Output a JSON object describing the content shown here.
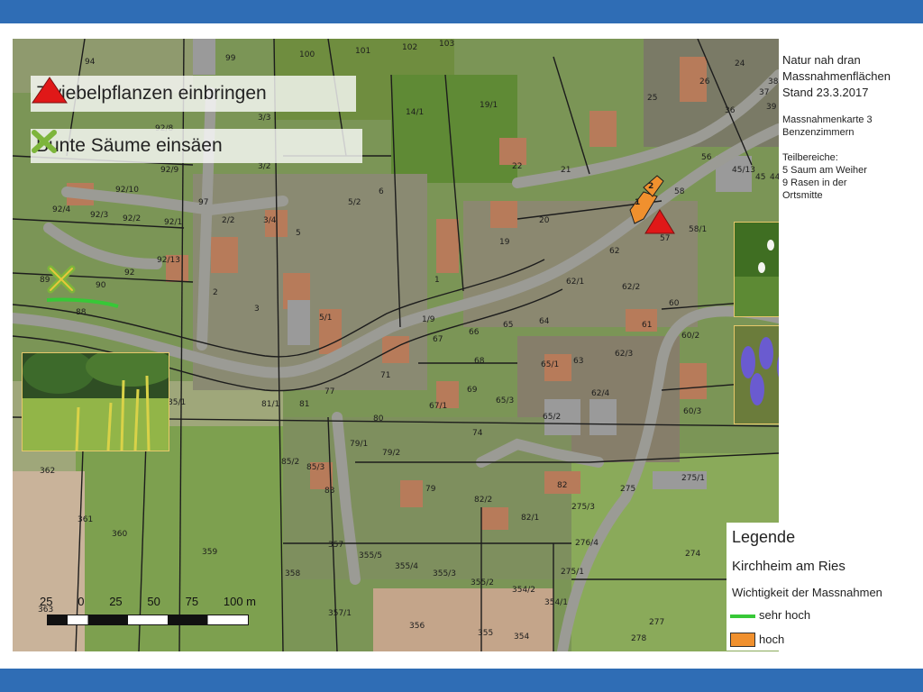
{
  "title_block": {
    "line1": "Natur nah dran",
    "line2": "Massnahmenflächen",
    "line3": "Stand 23.3.2017",
    "map_sheet": "Massnahmenkarte 3",
    "place_small": "Benzenzimmern",
    "areas_heading": "Teilbereiche:",
    "area_1": "5 Saum am Weiher",
    "area_2": "9 Rasen in der",
    "area_2b": "Ortsmitte"
  },
  "overlay": {
    "bulbs_label": "Zwiebelpflanzen einbringen",
    "margins_label": "Bunte Säume einsäen"
  },
  "legend": {
    "title": "Legende",
    "place": "Kirchheim am Ries",
    "importance_heading": "Wichtigkeit der Massnahmen",
    "item_very_high": "sehr hoch",
    "item_high": "hoch",
    "color_very_high": "#37c837",
    "color_high": "#f0902e"
  },
  "scale": {
    "labels": [
      "25",
      "0",
      "25",
      "50",
      "75",
      "100 m"
    ]
  },
  "markers": {
    "area_1_label": "1",
    "area_2_label": "2",
    "triangle_color": "#e01818",
    "cross_color": "#7db53b"
  },
  "parcels": [
    "94",
    "99",
    "100",
    "101",
    "102",
    "103",
    "14/1",
    "19/1",
    "24",
    "25",
    "26",
    "37",
    "36",
    "38",
    "39",
    "92/8",
    "3/3",
    "92/9",
    "3/2",
    "92/10",
    "92/4",
    "92/3",
    "92/2",
    "92/1",
    "97",
    "2/2",
    "3/4",
    "5/2",
    "6",
    "92/13",
    "2",
    "3",
    "5",
    "5/1",
    "1",
    "1/9",
    "21",
    "20",
    "19",
    "22",
    "45/13",
    "56",
    "58",
    "57",
    "58/1",
    "89",
    "90",
    "92",
    "88",
    "62",
    "62/1",
    "62/2",
    "64",
    "63",
    "65",
    "66",
    "67",
    "68",
    "69",
    "71",
    "60",
    "60/2",
    "61",
    "62/3",
    "65/1",
    "65/2",
    "65/3",
    "67/1",
    "62/4",
    "60/3",
    "85/1",
    "81/1",
    "81",
    "77",
    "80",
    "74",
    "79/1",
    "79/2",
    "85/2",
    "85/3",
    "83",
    "79",
    "82/2",
    "82/1",
    "82",
    "275",
    "275/1",
    "275/3",
    "276/4",
    "274",
    "362",
    "361",
    "360",
    "359",
    "358",
    "357",
    "355/5",
    "355/4",
    "355/3",
    "355/2",
    "354/2",
    "354/1",
    "275/1",
    "357/1",
    "356",
    "355",
    "354",
    "363",
    "277",
    "278",
    "44",
    "45"
  ]
}
